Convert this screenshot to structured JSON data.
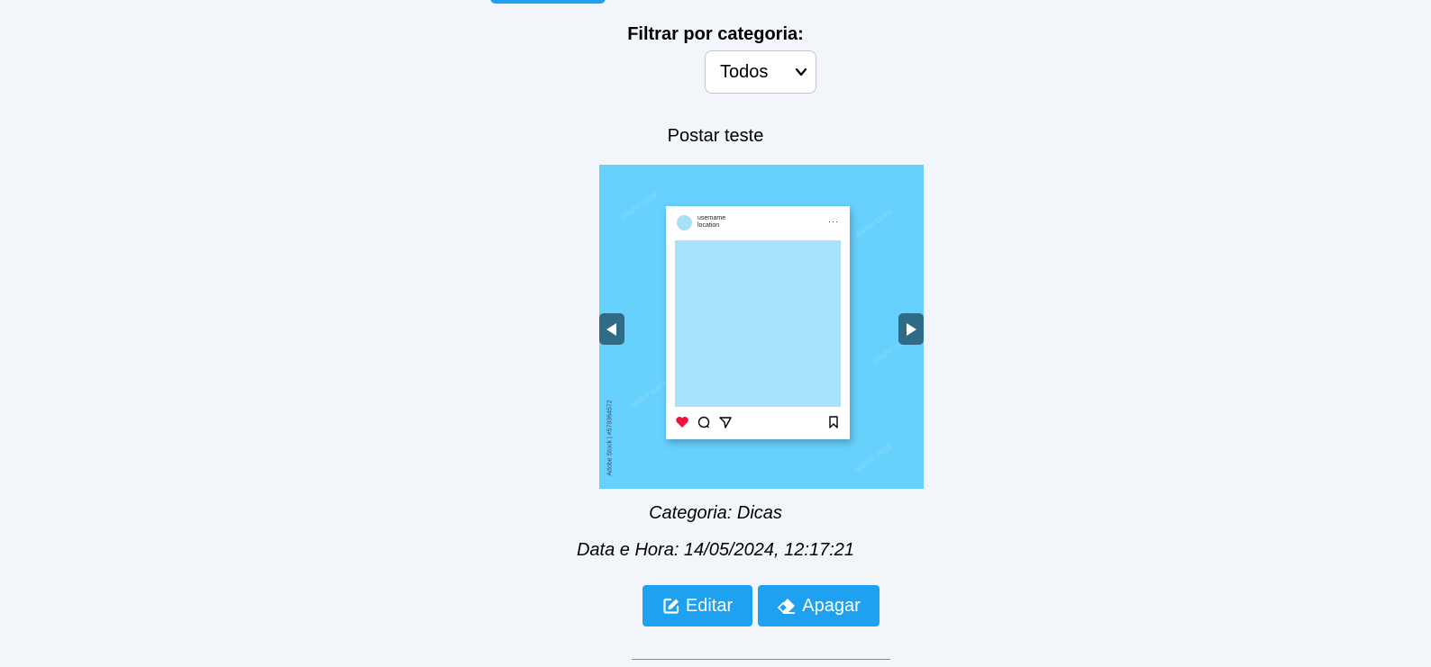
{
  "filter": {
    "label": "Filtrar por categoria:",
    "selected": "Todos"
  },
  "post": {
    "title": "Postar teste",
    "image": {
      "card_username": "username",
      "card_location": "location",
      "credit": "Adobe Stock | #579364572",
      "colors": {
        "background": "#67d1fe",
        "photo": "#a8e2fd",
        "heart": "#f0143c"
      }
    },
    "carousel": {
      "prev_icon": "triangle-left-icon",
      "next_icon": "triangle-right-icon"
    },
    "category_line": "Categoria: Dicas",
    "datetime_line": "Data e Hora: 14/05/2024, 12:17:21"
  },
  "actions": {
    "edit_label": "Editar",
    "edit_icon": "edit-square-icon",
    "delete_label": "Apagar",
    "delete_icon": "eraser-icon"
  },
  "theme": {
    "accent": "#1ea1f1",
    "page_bg": "#f2f6fa",
    "arrow_bg": "#2f6a86"
  }
}
